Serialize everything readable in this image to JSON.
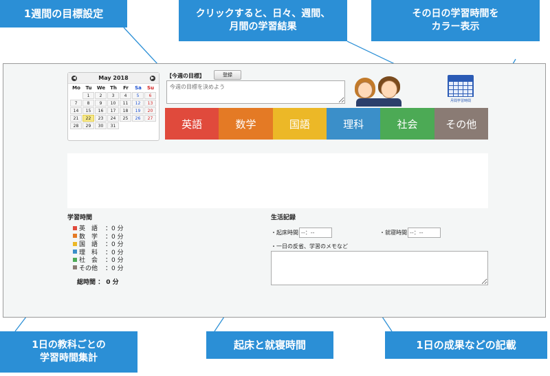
{
  "callouts": {
    "weekly_goal": "1週間の目標設定",
    "click_result_line1": "クリックすると、日々、週間、",
    "click_result_line2": "月間の学習結果",
    "color_line1": "その日の学習時間を",
    "color_line2": "カラー表示",
    "subject_total_line1": "1日の教科ごとの",
    "subject_total_line2": "学習時間集計",
    "wake_sleep": "起床と就寝時間",
    "daily_record": "1日の成果などの記載"
  },
  "calendar": {
    "month_title": "May 2018",
    "prev_icon": "chevron-left",
    "next_icon": "chevron-right",
    "weekdays": [
      "Mo",
      "Tu",
      "We",
      "Th",
      "Fr",
      "Sa",
      "Su"
    ],
    "weeks": [
      [
        "",
        "1",
        "2",
        "3",
        "4",
        "5",
        "6"
      ],
      [
        "7",
        "8",
        "9",
        "10",
        "11",
        "12",
        "13"
      ],
      [
        "14",
        "15",
        "16",
        "17",
        "18",
        "19",
        "20"
      ],
      [
        "21",
        "22",
        "23",
        "24",
        "25",
        "26",
        "27"
      ],
      [
        "28",
        "29",
        "30",
        "31",
        "",
        "",
        ""
      ]
    ],
    "today": "22",
    "colors": {
      "saturday": "#1a4fd0",
      "sunday": "#d21f1f",
      "today": "#f7e98a"
    }
  },
  "goal": {
    "label": "【今週の目標】",
    "button": "登録",
    "placeholder": "今週の目標を決めよう"
  },
  "month_icon_caption": "月間学習時間",
  "subjects": [
    {
      "label": "英語",
      "color": "#e04a3c"
    },
    {
      "label": "数学",
      "color": "#e47a25"
    },
    {
      "label": "国語",
      "color": "#ecb827"
    },
    {
      "label": "理科",
      "color": "#3b8fc9"
    },
    {
      "label": "社会",
      "color": "#4caa55"
    },
    {
      "label": "その他",
      "color": "#8a7b74"
    }
  ],
  "study": {
    "heading": "学習時間",
    "items": [
      {
        "label": "英　語",
        "value": "：0 分",
        "color": "#e04a3c"
      },
      {
        "label": "数　学",
        "value": "：0 分",
        "color": "#e47a25"
      },
      {
        "label": "国　語",
        "value": "：0 分",
        "color": "#ecb827"
      },
      {
        "label": "理　科",
        "value": "：0 分",
        "color": "#3b8fc9"
      },
      {
        "label": "社　会",
        "value": "：0 分",
        "color": "#4caa55"
      },
      {
        "label": "その他",
        "value": "：0 分",
        "color": "#8a7b74"
      }
    ],
    "total": "総時間 ： 0 分"
  },
  "life": {
    "heading": "生活記録",
    "wake_label": "・起床時間",
    "wake_value": "--：--",
    "sleep_label": "・就寝時間",
    "sleep_value": "--：--",
    "memo_label": "・一日の反省、学習のメモなど"
  },
  "accent_color": "#2b8fd6"
}
